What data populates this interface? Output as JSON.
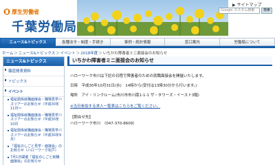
{
  "header": {
    "ministry": "厚生労働省",
    "bureau": "千葉労働局",
    "sitemap": "▶ サイトマップ",
    "search_placeholder": "Google カスタム検索",
    "search_button": "検索"
  },
  "nav": {
    "tabs": [
      {
        "label": "ニュース&トピックス",
        "active": true
      },
      {
        "label": "各種法令・制度・手続き",
        "active": false
      },
      {
        "label": "事例・統計情報",
        "active": false
      },
      {
        "label": "窓口案内",
        "active": false
      },
      {
        "label": "労働局について",
        "active": false
      }
    ]
  },
  "breadcrumb": {
    "items": [
      "ホーム",
      "ニュース&トピックス",
      "イベント",
      "2018年度"
    ],
    "current": "いちかわ障害者ミニ面接会のお知らせ"
  },
  "sidebar": {
    "title": "ニュース&トピックス",
    "items": [
      {
        "label": "報道発表資料",
        "active": false
      },
      {
        "label": "トピックス",
        "active": false
      },
      {
        "label": "イベント",
        "active": true
      }
    ],
    "subitems": [
      "福祉関係就職面接会・職場見学バスツアーのお知らせ（平成30年11月～",
      "福祉関係就職面接会・職場見学バスツアーのお知らせ（平成30年10月",
      "福祉関係就職面接会・職場見学バスツアーのお知らせ（平成30年9月）",
      "「福祉のしごと見学・面接会」のお知らせ（ハローワーク松戸）",
      "7月1日開催「福祉のしごと就職面接会」のお知らせ"
    ]
  },
  "main": {
    "title": "いちかわ障害者ミニ面接会のお知らせ",
    "intro": "ハローワーク市川は下記の日程で障害者のための就職面接会を開催いたします。",
    "date": "日時　平成30年10月31日(水)　14時から(受付は13時30分から行います。)",
    "place": "場所　アイ・リンクルーム(市川市市川南1-1-1 ザ・タワーズ・イースト3階)",
    "link": "※当日参加する求人一覧表はこちらをご覧ください。",
    "contact_label": "【問合せ先】",
    "contact_value": "ハローワーク市川　（047-370-8609）"
  }
}
